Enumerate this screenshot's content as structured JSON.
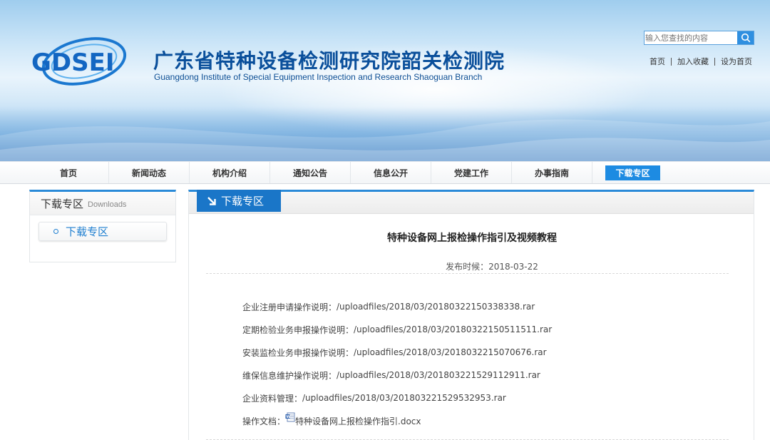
{
  "header": {
    "logo_text": "GDSEI",
    "title": "广东省特种设备检测研究院韶关检测院",
    "subtitle": "Guangdong Institute of Special Equipment Inspection and Research Shaoguan Branch",
    "search_placeholder": "输入您查找的内容",
    "search_icon": "search-icon",
    "top_links": [
      "首页",
      "加入收藏",
      "设为首页"
    ]
  },
  "nav": {
    "items": [
      "首页",
      "新闻动态",
      "机构介绍",
      "通知公告",
      "信息公开",
      "党建工作",
      "办事指南",
      "下载专区"
    ],
    "active": "下载专区"
  },
  "sidebar": {
    "title": "下载专区",
    "title_en": "Downloads",
    "items": [
      "下载专区"
    ]
  },
  "main": {
    "tab_label": "下载专区",
    "article": {
      "title": "特种设备网上报检操作指引及视频教程",
      "meta_label": "发布时候：",
      "date": "2018-03-22",
      "files": [
        {
          "label": "企业注册申请操作说明：",
          "path": "/uploadfiles/2018/03/20180322150338338.rar"
        },
        {
          "label": "定期检验业务申报操作说明：",
          "path": "/uploadfiles/2018/03/20180322150511511.rar"
        },
        {
          "label": "安装监检业务申报操作说明：",
          "path": "/uploadfiles/2018/03/2018032215070676.rar"
        },
        {
          "label": "维保信息维护操作说明：",
          "path": "/uploadfiles/2018/03/201803221529112911.rar"
        },
        {
          "label": "企业资料管理：",
          "path": "/uploadfiles/2018/03/201803221529532953.rar"
        },
        {
          "label": "操作文档：",
          "path": "特种设备网上报检操作指引.docx",
          "icon": "word-doc-icon"
        }
      ]
    }
  },
  "colors": {
    "brand_blue": "#1a76c8",
    "accent_blue": "#2a8ad8",
    "title_blue": "#0a4f9b",
    "nav_active": "#1d8be2"
  }
}
